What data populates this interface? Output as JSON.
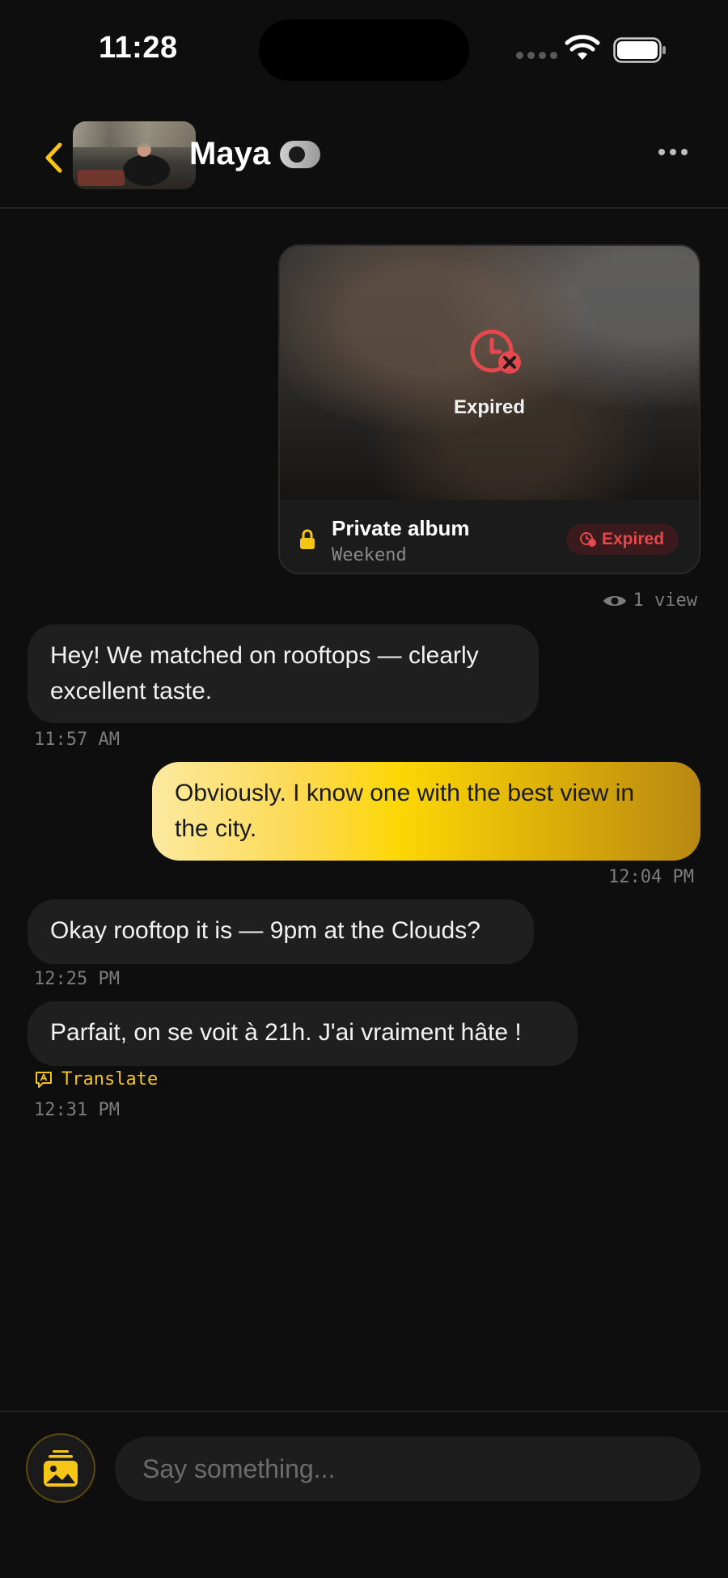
{
  "status_bar": {
    "time": "11:28"
  },
  "header": {
    "contact_name": "Maya"
  },
  "album": {
    "status_label": "Expired",
    "title": "Private album",
    "subtitle": "Weekend",
    "badge": "Expired",
    "views": "1 view"
  },
  "messages": [
    {
      "direction": "incoming",
      "line1": "Hey! We matched on rooftops — clearly",
      "line2": "excellent taste.",
      "time": "11:57 AM"
    },
    {
      "direction": "outgoing",
      "line1": "Obviously. I know one with the best view in",
      "line2": "the city.",
      "time": "12:04 PM"
    },
    {
      "direction": "incoming",
      "line1": "Okay rooftop it is — 9pm at the Clouds?",
      "time": "12:25 PM"
    },
    {
      "direction": "incoming",
      "line1": "Parfait, on se voit à 21h. J'ai vraiment hâte !",
      "time": "12:31 PM",
      "translate_label": "Translate"
    }
  ],
  "composer": {
    "placeholder": "Say something..."
  },
  "colors": {
    "accent": "#FCD705",
    "expired": "#E5484D",
    "background": "#0E0E0E",
    "incoming_bubble": "#1F1F1F"
  }
}
